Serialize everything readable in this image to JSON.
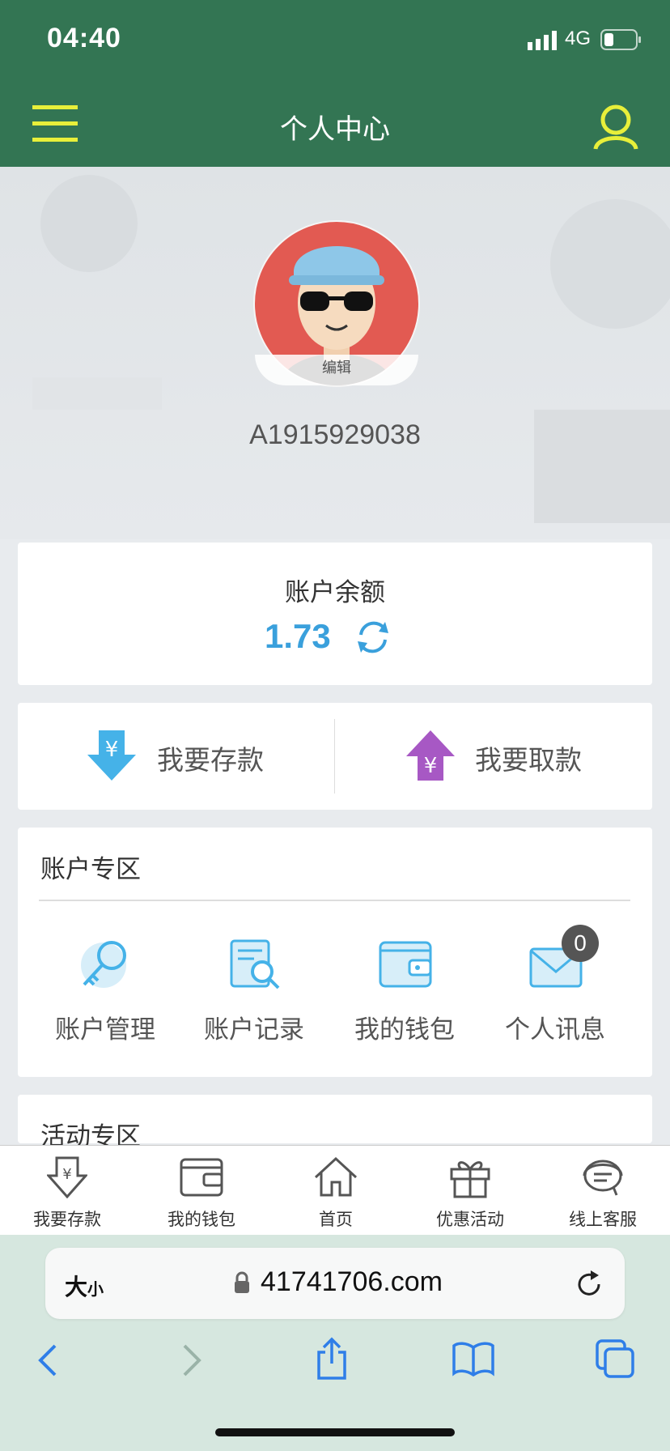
{
  "status_bar": {
    "time": "04:40",
    "network": "4G"
  },
  "header": {
    "title": "个人中心",
    "menu_icon": "hamburger-menu-icon",
    "user_icon": "user-profile-icon"
  },
  "profile": {
    "edit_label": "编辑",
    "username": "A1915929038"
  },
  "balance": {
    "label": "账户余额",
    "value": "1.73"
  },
  "actions": [
    {
      "label": "我要存款",
      "icon": "deposit-arrow-icon"
    },
    {
      "label": "我要取款",
      "icon": "withdraw-arrow-icon"
    }
  ],
  "account_zone": {
    "title": "账户专区",
    "items": [
      {
        "label": "账户管理",
        "icon": "key-icon"
      },
      {
        "label": "账户记录",
        "icon": "record-search-icon"
      },
      {
        "label": "我的钱包",
        "icon": "wallet-icon"
      },
      {
        "label": "个人讯息",
        "icon": "mail-icon",
        "badge": "0"
      }
    ]
  },
  "activity_zone": {
    "title": "活动专区"
  },
  "tabbar": [
    {
      "label": "我要存款",
      "icon": "deposit-tab-icon"
    },
    {
      "label": "我的钱包",
      "icon": "wallet-tab-icon"
    },
    {
      "label": "首页",
      "icon": "home-icon"
    },
    {
      "label": "优惠活动",
      "icon": "gift-icon"
    },
    {
      "label": "线上客服",
      "icon": "customer-service-icon"
    }
  ],
  "browser": {
    "text_size_label_big": "大",
    "text_size_label_small": "小",
    "url": "41741706.com"
  },
  "colors": {
    "header_green": "#337553",
    "accent_blue": "#3aa0dc",
    "browser_bg": "#d6e7df"
  }
}
